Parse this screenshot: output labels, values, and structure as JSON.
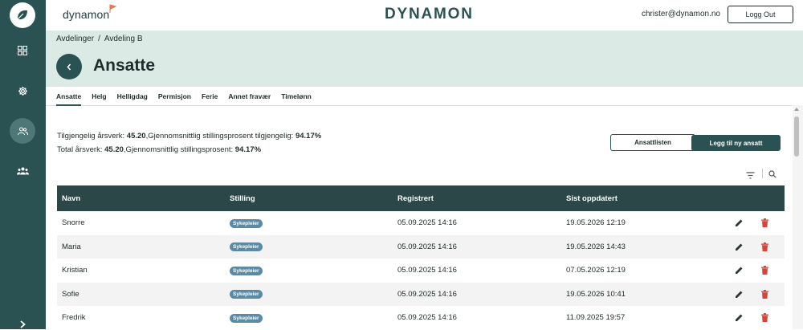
{
  "topbar": {
    "brand_small": "dynamon",
    "brand_big": "DYNAMON",
    "user_email": "christer@dynamon.no",
    "logout_label": "Logg Out"
  },
  "sidebar": {
    "items": [
      {
        "icon": "dashboard-icon",
        "active": false
      },
      {
        "icon": "gear-icon",
        "active": false
      },
      {
        "icon": "users-icon",
        "active": true
      },
      {
        "icon": "group-icon",
        "active": false
      }
    ],
    "expand_icon": "chevron-right-icon"
  },
  "breadcrumb": {
    "items": [
      "Avdelinger",
      "Avdeling B"
    ],
    "separator": "/"
  },
  "header": {
    "title": "Ansatte"
  },
  "tabs": [
    {
      "label": "Ansatte",
      "active": true
    },
    {
      "label": "Helg",
      "active": false
    },
    {
      "label": "Helligdag",
      "active": false
    },
    {
      "label": "Permisjon",
      "active": false
    },
    {
      "label": "Ferie",
      "active": false
    },
    {
      "label": "Annet fravær",
      "active": false
    },
    {
      "label": "Timelønn",
      "active": false
    }
  ],
  "stats": {
    "line1_label1": "Tilgjengelig årsverk: ",
    "line1_value1": "45.20",
    "line1_label2": ",Gjennomsnittlig stillingsprosent tilgjengelig: ",
    "line1_value2": "94.17%",
    "line2_label1": "Total årsverk: ",
    "line2_value1": "45.20",
    "line2_label2": ",Gjennomsnittlig stillingsprosent: ",
    "line2_value2": "94.17%"
  },
  "actions": {
    "list_button": "Ansattlisten",
    "add_button": "Legg til ny ansatt"
  },
  "table": {
    "headers": {
      "name": "Navn",
      "role": "Stilling",
      "registered": "Registrert",
      "updated": "Sist oppdatert"
    },
    "rows": [
      {
        "name": "Snorre",
        "role": "Sykepleier",
        "registered": "05.09.2025 14:16",
        "updated": "19.05.2026 12:19"
      },
      {
        "name": "Maria",
        "role": "Sykepleier",
        "registered": "05.09.2025 14:16",
        "updated": "19.05.2026 14:43"
      },
      {
        "name": "Kristian",
        "role": "Sykepleier",
        "registered": "05.09.2025 14:16",
        "updated": "07.05.2026 12:19"
      },
      {
        "name": "Sofie",
        "role": "Sykepleier",
        "registered": "05.09.2025 14:16",
        "updated": "19.05.2026 10:41"
      },
      {
        "name": "Fredrik",
        "role": "Sykepleier",
        "registered": "05.09.2025 14:16",
        "updated": "11.09.2025 19:57"
      }
    ]
  },
  "colors": {
    "primary": "#2b5252",
    "header_bg": "#dceae6",
    "badge": "#5a8aa4",
    "delete": "#d5453a"
  }
}
